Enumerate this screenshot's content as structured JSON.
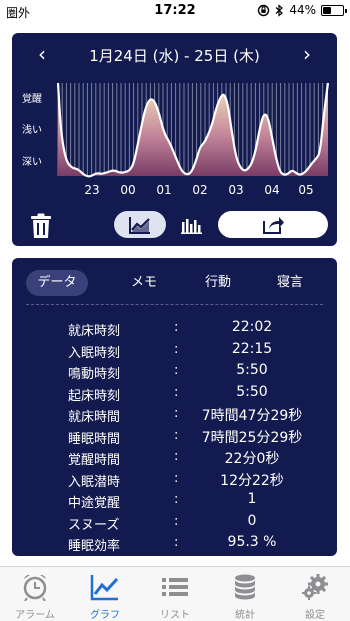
{
  "status": {
    "carrier": "圏外",
    "time": "17:22",
    "battery": "44%",
    "battery_level": 0.44
  },
  "header": {
    "title": "1月24日 (水) - 25日 (木)",
    "prev": "‹",
    "next": "›"
  },
  "chart": {
    "y_labels": [
      "覚醒",
      "浅い",
      "深い"
    ],
    "x_labels": [
      "23",
      "00",
      "01",
      "02",
      "03",
      "04",
      "05"
    ],
    "colors": {
      "fill_top": "#f3e6bd",
      "fill_bottom": "#7a3b66",
      "line": "#ffffff",
      "bg": "#131a4f"
    }
  },
  "controls": {
    "trash_icon": "trash-icon",
    "line_icon": "line-chart-icon",
    "bar_icon": "bar-chart-icon",
    "share_icon": "share-icon"
  },
  "tabs": [
    "データ",
    "メモ",
    "行動",
    "寝言"
  ],
  "rows": [
    {
      "label": "就床時刻",
      "value": "22:02"
    },
    {
      "label": "入眠時刻",
      "value": "22:15"
    },
    {
      "label": "鳴動時刻",
      "value": "5:50"
    },
    {
      "label": "起床時刻",
      "value": "5:50"
    },
    {
      "label": "就床時間",
      "value": "7時間47分29秒"
    },
    {
      "label": "睡眠時間",
      "value": "7時間25分29秒"
    },
    {
      "label": "覚醒時間",
      "value": "22分0秒"
    },
    {
      "label": "入眠潜時",
      "value": "12分22秒"
    },
    {
      "label": "中途覚醒",
      "value": "1"
    },
    {
      "label": "スヌーズ",
      "value": "0"
    },
    {
      "label": "睡眠効率",
      "value": "95.3 %"
    }
  ],
  "colon": ":",
  "tabbar": [
    {
      "label": "アラーム",
      "icon": "alarm-clock-icon"
    },
    {
      "label": "グラフ",
      "icon": "graph-icon"
    },
    {
      "label": "リスト",
      "icon": "list-icon"
    },
    {
      "label": "統計",
      "icon": "database-icon"
    },
    {
      "label": "設定",
      "icon": "gear-icon"
    }
  ]
}
